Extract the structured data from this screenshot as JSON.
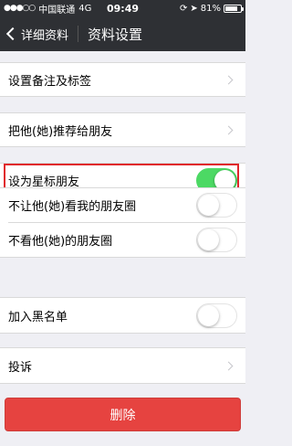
{
  "status_bar": {
    "carrier": "中国联通",
    "network": "4G",
    "time": "09:49",
    "battery": "81%",
    "battery_level": 0.81
  },
  "nav": {
    "back_label": "详细资料",
    "title": "资料设置"
  },
  "rows": {
    "remark": "设置备注及标签",
    "recommend": "把他(她)推荐给朋友",
    "star": "设为星标朋友",
    "hide_moments": "不让他(她)看我的朋友圈",
    "not_see": "不看他(她)的朋友圈",
    "blacklist": "加入黑名单",
    "report": "投诉"
  },
  "toggles": {
    "star": true,
    "hide_moments": false,
    "not_see": false,
    "blacklist": false
  },
  "delete_label": "删除",
  "colors": {
    "nav_bg": "#2e3034",
    "toggle_on": "#4cd964",
    "delete_bg": "#e64340",
    "highlight": "#e0262b"
  }
}
